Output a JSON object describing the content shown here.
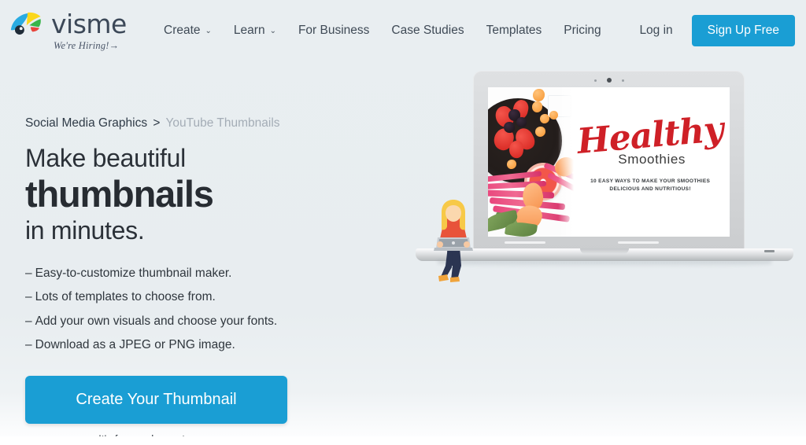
{
  "header": {
    "brand": {
      "wordmark": "visme",
      "hiring_label": "We're Hiring!",
      "hiring_arrow": "→",
      "logo_icon": "visme-chameleon-logo"
    },
    "nav": [
      {
        "label": "Create",
        "has_caret": true,
        "caret": "⌄"
      },
      {
        "label": "Learn",
        "has_caret": true,
        "caret": "⌄"
      },
      {
        "label": "For Business",
        "has_caret": false,
        "caret": ""
      },
      {
        "label": "Case Studies",
        "has_caret": false,
        "caret": ""
      },
      {
        "label": "Templates",
        "has_caret": false,
        "caret": ""
      },
      {
        "label": "Pricing",
        "has_caret": false,
        "caret": ""
      }
    ],
    "login_label": "Log in",
    "signup_label": "Sign Up Free"
  },
  "hero": {
    "breadcrumb": {
      "parent": "Social Media Graphics",
      "separator": ">",
      "current": "YouTube Thumbnails"
    },
    "headline": {
      "line1": "Make beautiful",
      "line2": "thumbnails",
      "line3": "in minutes."
    },
    "features": [
      {
        "dash": "–",
        "text": "Easy-to-customize thumbnail maker."
      },
      {
        "dash": "–",
        "text": "Lots of templates to choose from."
      },
      {
        "dash": "–",
        "text": "Add your own visuals and choose your fonts."
      },
      {
        "dash": "–",
        "text": "Download as a JPEG or PNG image."
      }
    ],
    "cta_label": "Create Your Thumbnail",
    "cta_note": "It's free and easy to use."
  },
  "artwork": {
    "device": "laptop-mockup",
    "illustration": "woman-with-laptop-illustration",
    "slide": {
      "title": "Healthy",
      "subtitle": "Smoothies",
      "tagline_line1": "10 EASY WAYS TO MAKE YOUR SMOOTHIES",
      "tagline_line2": "DELICIOUS AND NUTRITIOUS!"
    }
  },
  "colors": {
    "accent_blue": "#1a9ed4",
    "page_bg": "#e9eef1",
    "headline_dark": "#272c32",
    "breadcrumb_muted": "#a4adb6",
    "slide_red": "#cf2027"
  }
}
